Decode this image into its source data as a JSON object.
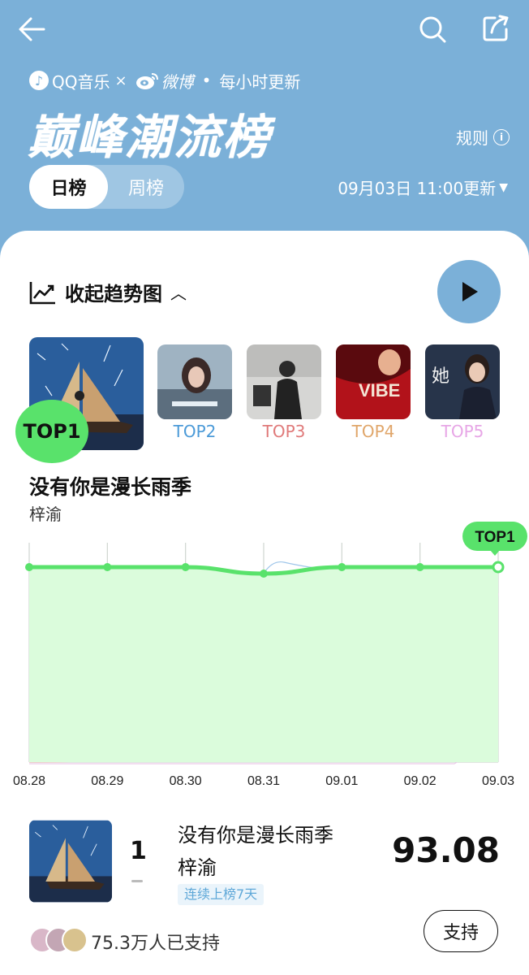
{
  "header": {
    "brand_qq": "QQ音乐",
    "brand_sep": "×",
    "brand_weibo": "微博",
    "brand_dot": "•",
    "brand_update": "每小时更新",
    "title": "巅峰潮流榜",
    "rules_label": "规则",
    "tabs": [
      {
        "label": "日榜"
      },
      {
        "label": "周榜"
      }
    ],
    "update_time": "09月03日 11:00更新",
    "accent": "#7bb0d8"
  },
  "trend": {
    "collapse_label": "收起趋势图",
    "top_list": [
      {
        "label": "TOP1",
        "color": "#111111"
      },
      {
        "label": "TOP2",
        "color": "#4b9ad8"
      },
      {
        "label": "TOP3",
        "color": "#e07a7a"
      },
      {
        "label": "TOP4",
        "color": "#e0a66a"
      },
      {
        "label": "TOP5",
        "color": "#e7a6e6"
      }
    ],
    "selected_title": "没有你是漫长雨季",
    "selected_artist": "梓渝",
    "badge": "TOP1"
  },
  "chart_data": {
    "type": "line",
    "x": [
      "08.28",
      "08.29",
      "08.30",
      "08.31",
      "09.01",
      "09.02",
      "09.03"
    ],
    "series": [
      {
        "name": "没有你是漫长雨季",
        "values": [
          1,
          1,
          1,
          1,
          1,
          1,
          1
        ]
      }
    ],
    "current_label": "TOP1",
    "grid": true
  },
  "list": [
    {
      "rank": "1",
      "title": "没有你是漫长雨季",
      "artist": "梓渝",
      "tag": "连续上榜7天",
      "score": "93.08",
      "supporters": "75.3万人已支持",
      "support_label": "支持"
    }
  ]
}
